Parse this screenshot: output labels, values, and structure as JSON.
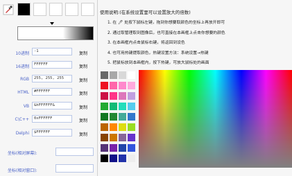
{
  "rows": [
    {
      "label": "10进制",
      "value": "-1",
      "copy": "复制"
    },
    {
      "label": "16进制",
      "value": "FFFFFF",
      "copy": "复制"
    },
    {
      "label": "RGB",
      "value": "255, 255, 255",
      "copy": "复制"
    },
    {
      "label": "HTML",
      "value": "#FFFFFF",
      "copy": "复制"
    },
    {
      "label": "VB",
      "value": "&hFFFFFF&",
      "copy": "复制"
    },
    {
      "label": "C\\C++",
      "value": "0xFFFFFF",
      "copy": "复制"
    },
    {
      "label": "Delphi",
      "value": "$FFFFFF",
      "copy": "复制"
    }
  ],
  "coords": {
    "screen_label": "坐标(相对屏幕):",
    "window_label": "坐标(相对窗口):"
  },
  "instructions": {
    "title": "使用说明:(在系统设置里可以设置放大的倍数)",
    "steps": [
      "1. 在 🖊 处按下鼠标左键，拖到你想要取颜色的坐标上再放开即可",
      "2. 通过取管理取到图像后，也可直接在本画框上点击你想要的颜色",
      "3. 在本画框内点击鼠标右键，将返回到设色",
      "4. 也可用热键提取颜色，热键设置方法：系统设置→热键",
      "5. 把鼠标放到本画框内，按下热键，可放大鼠标处的画面"
    ]
  },
  "palette": [
    [
      "#686868",
      "#a8a8a8",
      "#d8d8d8",
      "#ffffff"
    ],
    [
      "#ee1122",
      "#ff66aa",
      "#ff88cc",
      "#ffaadd"
    ],
    [
      "#cc1144",
      "#ff3388",
      "#dd77bb",
      "#c0a0e0"
    ],
    [
      "#22aa33",
      "#11bb77",
      "#22ddbb",
      "#55ccee"
    ],
    [
      "#117722",
      "#228833",
      "#44aa99",
      "#3377cc"
    ],
    [
      "#bb6600",
      "#ff8800",
      "#dddd11",
      "#99dd22"
    ],
    [
      "#884400",
      "#cc7700",
      "#886699",
      "#6633cc"
    ],
    [
      "#553377",
      "#7722aa",
      "#2244aa",
      "#3355dd"
    ],
    [
      "#000000",
      "#111188",
      "#2233aa",
      "#eeeeee"
    ]
  ]
}
